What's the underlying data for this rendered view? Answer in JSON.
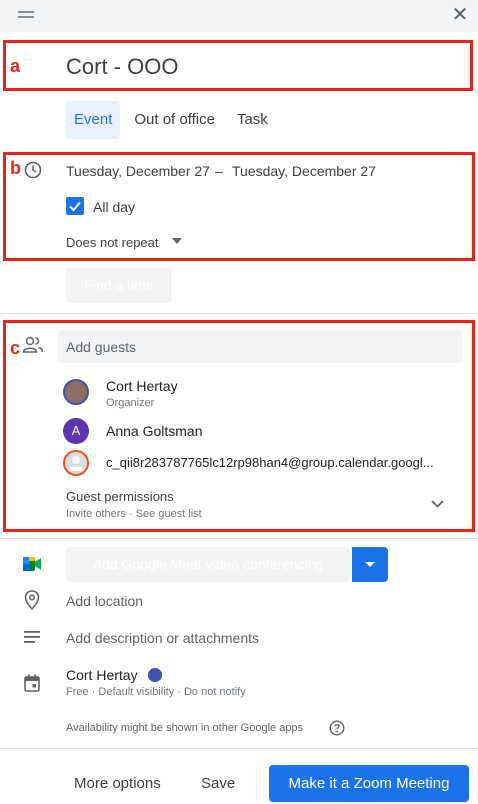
{
  "event": {
    "title": "Cort - OOO",
    "tabs": [
      "Event",
      "Out of office",
      "Task"
    ],
    "start_date": "Tuesday, December 27",
    "dash": "–",
    "end_date": "Tuesday, December 27",
    "all_day_label": "All day",
    "repeat_label": "Does not repeat",
    "find_time_label": "Find a time"
  },
  "markers": {
    "a": "a",
    "b": "b",
    "c": "c"
  },
  "guests": {
    "placeholder": "Add guests",
    "list": [
      {
        "name": "Cort Hertay",
        "role": "Organizer"
      },
      {
        "name": "Anna Goltsman",
        "initial": "A"
      },
      {
        "name": "c_qii8r283787765lc12rp98han4@group.calendar.googl..."
      }
    ],
    "permissions_label": "Guest permissions",
    "permissions_sub": "Invite others · See guest list"
  },
  "meet_label": "Add Google Meet video conferencing",
  "location_label": "Add location",
  "description_label": "Add description or attachments",
  "calendar": {
    "name": "Cort Hertay",
    "details": "Free · Default visibility · Do not notify",
    "color": "#3f51b5"
  },
  "availability_note": "Availability might be shown in other Google apps",
  "footer": {
    "more_options": "More options",
    "save": "Save",
    "zoom": "Make it a Zoom Meeting"
  },
  "colors": {
    "accent": "#1a73e8",
    "highlight": "#e8231b"
  }
}
